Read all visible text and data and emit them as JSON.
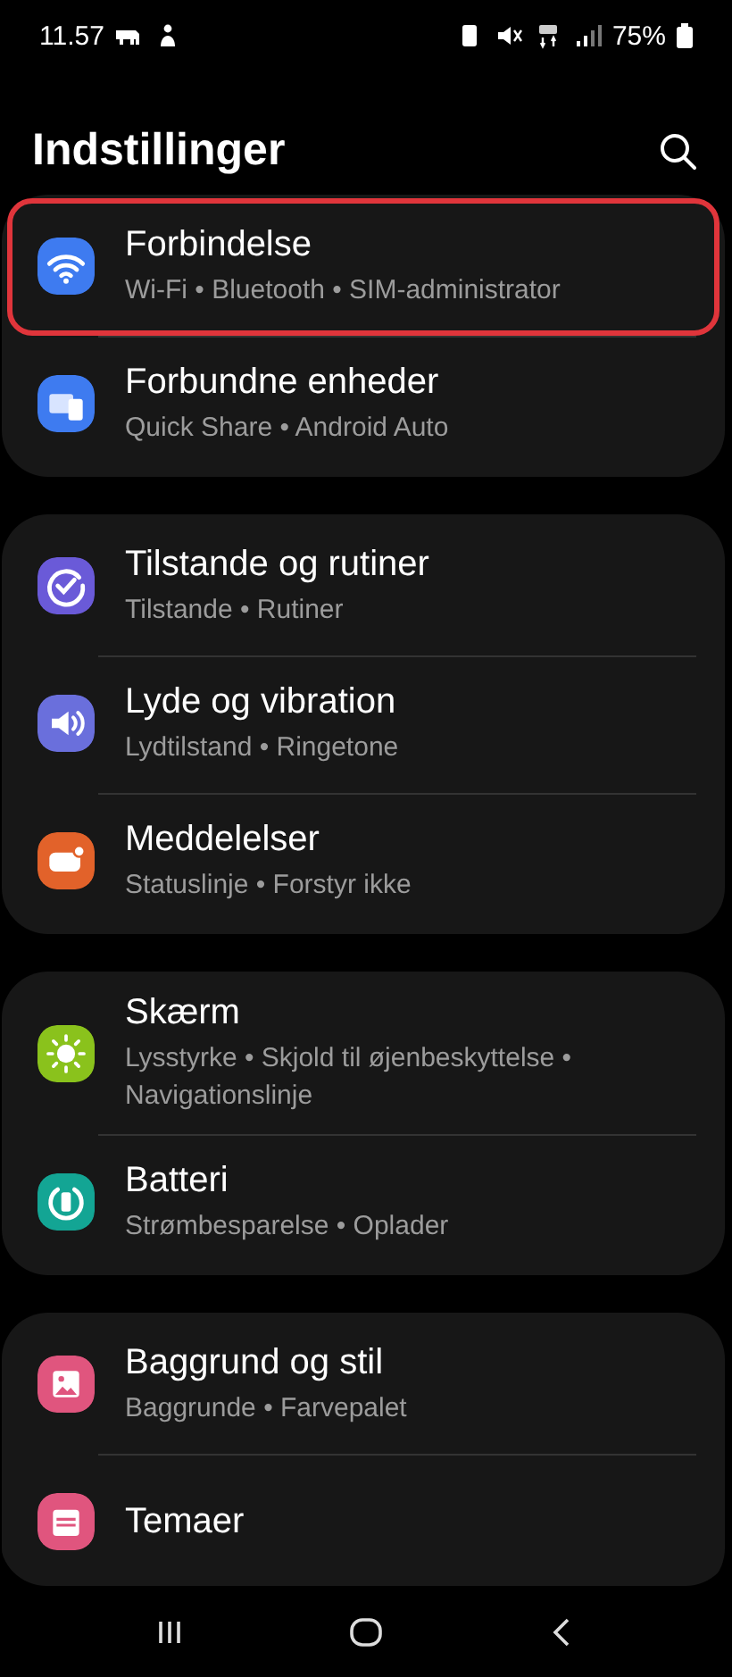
{
  "status_bar": {
    "time": "11.57",
    "battery": "75%"
  },
  "header": {
    "title": "Indstillinger"
  },
  "groups": [
    {
      "items": [
        {
          "kind": "wifi",
          "color": "#3e7bf0",
          "title": "Forbindelse",
          "subtitle": "Wi-Fi • Bluetooth • SIM-administrator",
          "highlighted": true
        },
        {
          "kind": "devices",
          "color": "#3e7bf0",
          "title": "Forbundne enheder",
          "subtitle": "Quick Share • Android Auto",
          "highlighted": false
        }
      ]
    },
    {
      "items": [
        {
          "kind": "check",
          "color": "#6a5ad8",
          "title": "Tilstande og rutiner",
          "subtitle": "Tilstande • Rutiner",
          "highlighted": false
        },
        {
          "kind": "sound",
          "color": "#6a6fdc",
          "title": "Lyde og vibration",
          "subtitle": "Lydtilstand • Ringetone",
          "highlighted": false
        },
        {
          "kind": "notification",
          "color": "#e2622a",
          "title": "Meddelelser",
          "subtitle": "Statuslinje • Forstyr ikke",
          "highlighted": false
        }
      ]
    },
    {
      "items": [
        {
          "kind": "sun",
          "color": "#8ac21c",
          "title": "Skærm",
          "subtitle": "Lysstyrke • Skjold til øjenbeskyttelse • Navigationslinje",
          "highlighted": false
        },
        {
          "kind": "battery",
          "color": "#13a594",
          "title": "Batteri",
          "subtitle": "Strømbesparelse • Oplader",
          "highlighted": false
        }
      ]
    },
    {
      "items": [
        {
          "kind": "image",
          "color": "#e0557e",
          "title": "Baggrund og stil",
          "subtitle": "Baggrunde • Farvepalet",
          "highlighted": false
        },
        {
          "kind": "theme",
          "color": "#e0557e",
          "title": "Temaer",
          "highlighted": false
        }
      ]
    }
  ]
}
